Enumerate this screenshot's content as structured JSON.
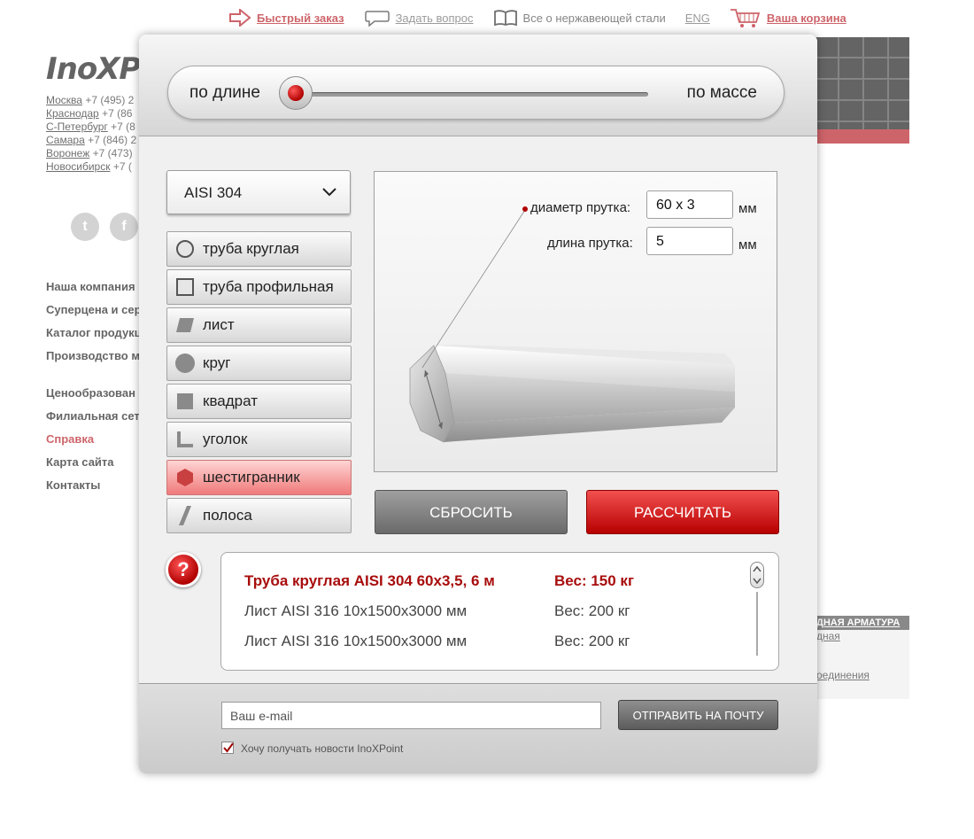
{
  "topbar": {
    "quick_order": "Быстрый заказ",
    "ask_question": "Задать вопрос",
    "about_steel": "Все о нержавеющей стали",
    "lang": "ENG",
    "cart": "Ваша корзина"
  },
  "site": {
    "logo": "InoXP",
    "cities": [
      {
        "name": "Москва",
        "phone": "+7 (495) 2"
      },
      {
        "name": "Краснодар",
        "phone": "+7 (86"
      },
      {
        "name": "С-Петербург",
        "phone": "+7 (8"
      },
      {
        "name": "Самара",
        "phone": "+7 (846) 2"
      },
      {
        "name": "Воронеж",
        "phone": "+7 (473)"
      },
      {
        "name": "Новосибирск",
        "phone": "+7 ("
      }
    ],
    "social": [
      "t",
      "f"
    ],
    "nav": [
      "Наша компания",
      "Суперцена и сер",
      "Каталог продукц",
      "Производство металлопроката",
      "Ценообразован",
      "Филиальная сет",
      "Справка",
      "Карта сайта",
      "Контакты"
    ],
    "side_box": {
      "head": "ДНАЯ АРМАТУРА",
      "link1": "дная",
      "link2": "оединения"
    }
  },
  "calc": {
    "mode_left": "по длине",
    "mode_right": "по массе",
    "steel_grade": "AISI 304",
    "shapes": [
      {
        "label": "труба круглая",
        "icon": "circle-outline-icon"
      },
      {
        "label": "труба профильная",
        "icon": "square-outline-icon"
      },
      {
        "label": "лист",
        "icon": "sheet-icon"
      },
      {
        "label": "круг",
        "icon": "circle-filled-icon"
      },
      {
        "label": "квадрат",
        "icon": "square-filled-icon"
      },
      {
        "label": "уголок",
        "icon": "angle-icon"
      },
      {
        "label": "шестигранник",
        "icon": "hexagon-icon"
      },
      {
        "label": "полоса",
        "icon": "strip-icon"
      }
    ],
    "active_shape_index": 6,
    "diameter_label": "диаметр прутка:",
    "diameter_value": "60 x 3",
    "length_label": "длина прутка:",
    "length_value": "5",
    "unit": "мм",
    "reset_button": "СБРОСИТЬ",
    "calc_button": "РАССЧИТАТЬ",
    "help": "?",
    "results": [
      {
        "name": "Труба круглая AISI 304 60x3,5, 6 м",
        "weight": "Вес: 150 кг"
      },
      {
        "name": "Лист AISI 316 10x1500x3000 мм",
        "weight": "Вес: 200 кг"
      },
      {
        "name": "Лист AISI 316 10x1500x3000 мм",
        "weight": "Вес: 200 кг"
      }
    ],
    "email_placeholder": "Ваш e-mail",
    "send_button": "ОТПРАВИТЬ НА ПОЧТУ",
    "newsletter_label": "Хочу получать новости InoXPoint",
    "newsletter_checked": true
  },
  "colors": {
    "accent_red": "#b3121b",
    "active_shape_bg": "#f07a7a"
  }
}
